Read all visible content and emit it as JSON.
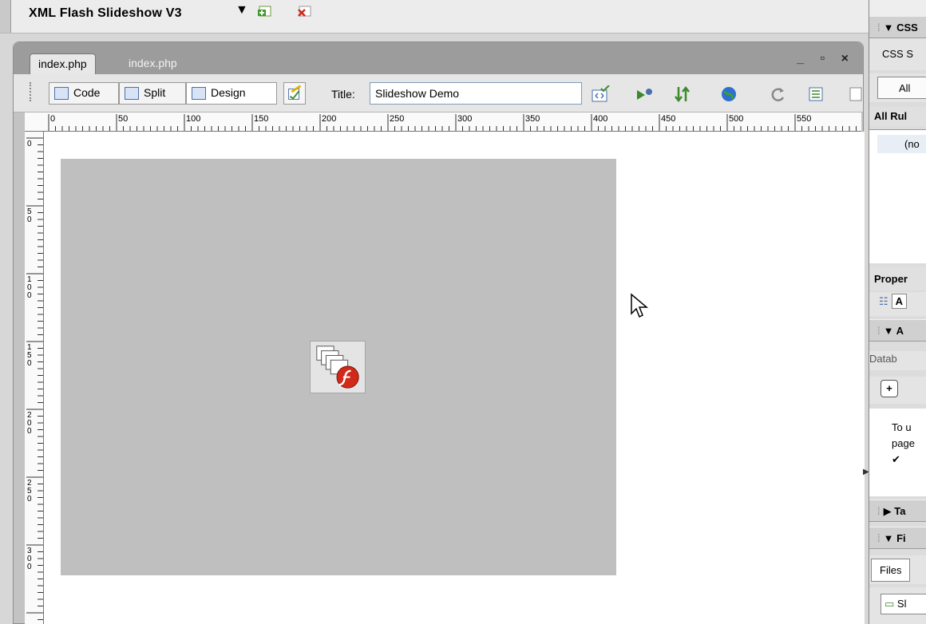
{
  "extension_bar": {
    "title": "XML Flash Slideshow V3",
    "menu_arrow": "▼"
  },
  "document": {
    "tabs": [
      {
        "label": "index.php",
        "active": true
      },
      {
        "label": "index.php",
        "active": false
      }
    ],
    "window_controls": "_ ▫ ×"
  },
  "toolbar": {
    "code_label": "Code",
    "split_label": "Split",
    "design_label": "Design",
    "title_label": "Title:",
    "title_value": "Slideshow Demo"
  },
  "ruler": {
    "horizontal_ticks": [
      "0",
      "50",
      "100",
      "150",
      "200",
      "250",
      "300",
      "350",
      "400",
      "450",
      "500",
      "550"
    ],
    "vertical_ticks": [
      "0",
      "50",
      "100",
      "150",
      "200",
      "250",
      "300"
    ]
  },
  "canvas": {
    "stage_color": "#bfbfbf",
    "placeholder_icon": "flash-slideshow-icon"
  },
  "panels": {
    "css_header": "▼ CSS",
    "css_sub": "CSS S",
    "all_button": "All",
    "all_rules": "All Rul",
    "rules_item": "(no",
    "properties": "Proper",
    "props_btn": "A",
    "app_header": "▼ A",
    "databases": "Datab",
    "app_text_1": "To u",
    "app_text_2": "page",
    "check": "✔",
    "tag_header": "▶ Ta",
    "files_header": "▼ Fi",
    "files_tab": "Files",
    "site_item": "Sl"
  },
  "colors": {
    "accent_blue": "#4a6fa8",
    "flash_red": "#d22a1a"
  }
}
